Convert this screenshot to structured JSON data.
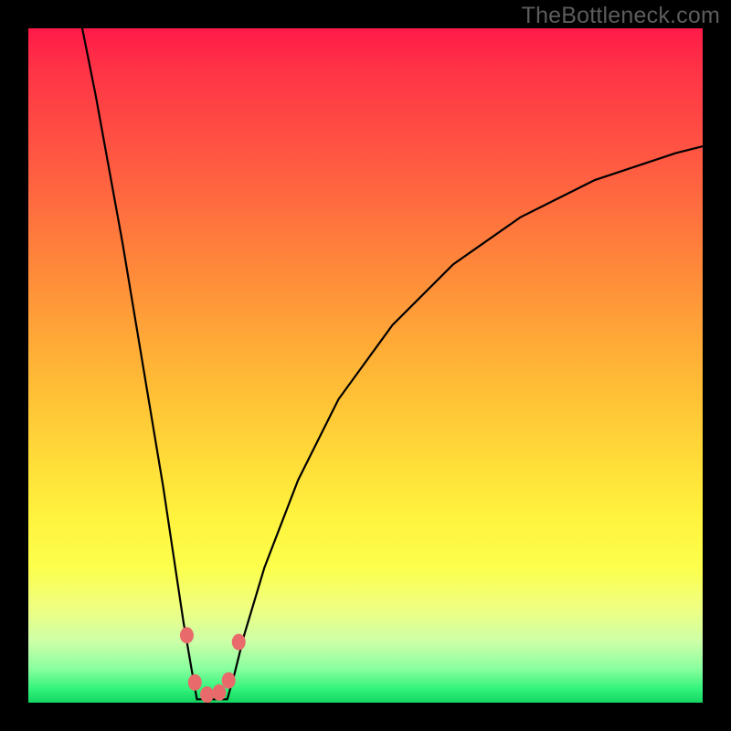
{
  "watermark": {
    "text": "TheBottleneck.com"
  },
  "colors": {
    "frame": "#000000",
    "curve_stroke": "#000000",
    "marker_fill": "#e86a6a",
    "marker_stroke": "#d25a5a"
  },
  "chart_data": {
    "type": "line",
    "title": "",
    "xlabel": "",
    "ylabel": "",
    "xlim": [
      0,
      100
    ],
    "ylim": [
      0,
      100
    ],
    "grid": false,
    "legend": false,
    "series": [
      {
        "name": "left-branch",
        "x": [
          8,
          10,
          12,
          14,
          16,
          18,
          20,
          21.5,
          23,
          24.2,
          25
        ],
        "y": [
          100,
          90,
          79,
          68,
          56,
          44,
          32,
          22,
          12,
          5,
          0.5
        ]
      },
      {
        "name": "right-branch",
        "x": [
          29.5,
          30.5,
          32,
          35,
          40,
          46,
          54,
          63,
          73,
          84,
          96,
          100
        ],
        "y": [
          0.5,
          4,
          10,
          20,
          33,
          45,
          56,
          65,
          72,
          77.5,
          81.5,
          82.5
        ]
      }
    ],
    "floor": {
      "name": "valley-floor",
      "x": [
        25,
        29.5
      ],
      "y": [
        0.5,
        0.5
      ]
    },
    "markers": [
      {
        "x": 23.5,
        "y": 10
      },
      {
        "x": 24.7,
        "y": 3
      },
      {
        "x": 26.5,
        "y": 1.2
      },
      {
        "x": 28.3,
        "y": 1.5
      },
      {
        "x": 29.7,
        "y": 3.3
      },
      {
        "x": 31.2,
        "y": 9
      }
    ],
    "background_gradient": {
      "direction": "vertical",
      "stops": [
        {
          "pos": 0,
          "color": "#ff1a49"
        },
        {
          "pos": 20,
          "color": "#ff5a42"
        },
        {
          "pos": 50,
          "color": "#ffb436"
        },
        {
          "pos": 72,
          "color": "#fff23d"
        },
        {
          "pos": 91,
          "color": "#ccffa8"
        },
        {
          "pos": 100,
          "color": "#14d561"
        }
      ]
    }
  }
}
